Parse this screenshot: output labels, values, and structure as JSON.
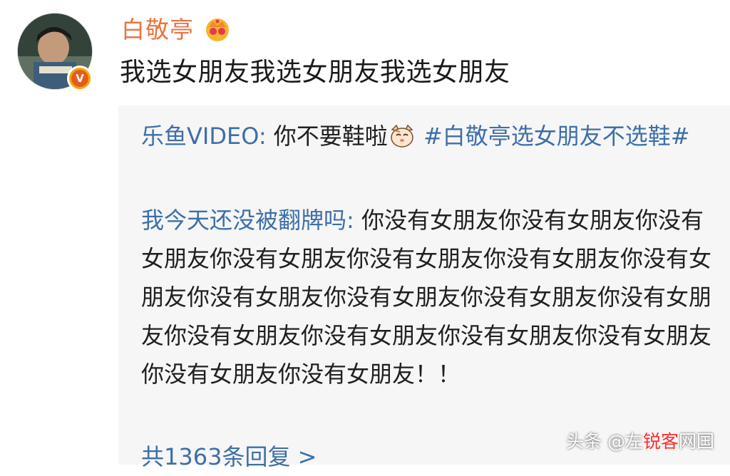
{
  "post": {
    "username": "白敬亭",
    "verified_mark": "V",
    "text": "我选女朋友我选女朋友我选女朋友"
  },
  "replies": [
    {
      "author": "乐鱼VIDEO:",
      "text_before_emoji": " 你不要鞋啦",
      "emoji": "cat-face-icon",
      "hashtag": " #白敬亭选女朋友不选鞋#"
    },
    {
      "author": "我今天还没被翻牌吗:",
      "text": " 你没有女朋友你没有女朋友你没有女朋友你没有女朋友你没有女朋友你没有女朋友你没有女朋友你没有女朋友你没有女朋友你没有女朋友你没有女朋友你没有女朋友你没有女朋友你没有女朋友你没有女朋友你没有女朋友你没有女朋友！！"
    }
  ],
  "reply_count": "共1363条回复 >",
  "watermark": {
    "prefix": "头条 @左",
    "highlight": "锐客",
    "suffix": "网国"
  },
  "colors": {
    "username": "#eb7340",
    "link": "#3d6fa8",
    "reply_bg": "#f6f6f6"
  }
}
